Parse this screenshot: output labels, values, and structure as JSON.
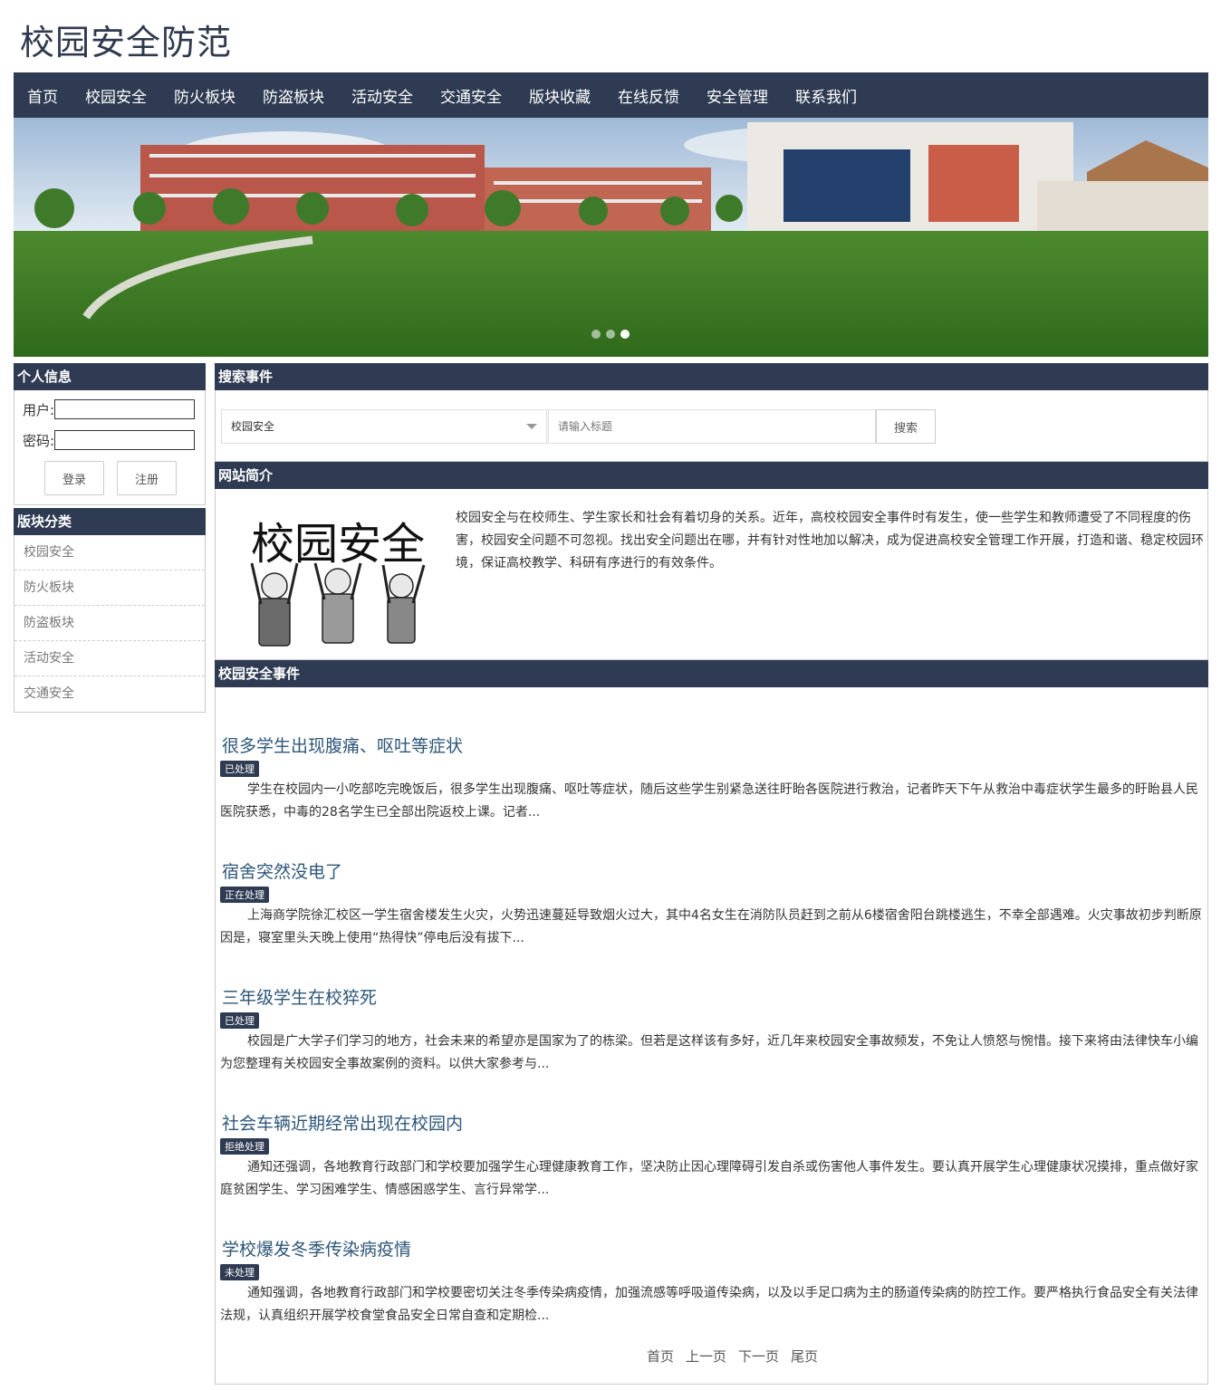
{
  "site": {
    "title": "校园安全防范"
  },
  "nav": [
    "首页",
    "校园安全",
    "防火板块",
    "防盗板块",
    "活动安全",
    "交通安全",
    "版块收藏",
    "在线反馈",
    "安全管理",
    "联系我们"
  ],
  "personal": {
    "heading": "个人信息",
    "user_label": "用户:",
    "pass_label": "密码:",
    "login_label": "登录",
    "register_label": "注册"
  },
  "categories": {
    "heading": "版块分类",
    "items": [
      "校园安全",
      "防火板块",
      "防盗板块",
      "活动安全",
      "交通安全"
    ]
  },
  "search": {
    "heading": "搜索事件",
    "selected": "校园安全",
    "placeholder": "请输入标题",
    "button": "搜索"
  },
  "intro": {
    "heading": "网站简介",
    "image_text": "校园安全",
    "text": "校园安全与在校师生、学生家长和社会有着切身的关系。近年，高校校园安全事件时有发生，使一些学生和教师遭受了不同程度的伤害，校园安全问题不可忽视。找出安全问题出在哪，并有针对性地加以解决，成为促进高校安全管理工作开展，打造和谐、稳定校园环境，保证高校教学、科研有序进行的有效条件。"
  },
  "events": {
    "heading": "校园安全事件",
    "items": [
      {
        "title": "很多学生出现腹痛、呕吐等症状",
        "status": "已处理",
        "text": "学生在校园内一小吃部吃完晚饭后，很多学生出现腹痛、呕吐等症状，随后这些学生别紧急送往盱眙各医院进行救治，记者昨天下午从救治中毒症状学生最多的盱眙县人民医院获悉，中毒的28名学生已全部出院返校上课。记者..."
      },
      {
        "title": "宿舍突然没电了",
        "status": "正在处理",
        "text": "上海商学院徐汇校区一学生宿舍楼发生火灾，火势迅速蔓延导致烟火过大，其中4名女生在消防队员赶到之前从6楼宿舍阳台跳楼逃生，不幸全部遇难。火灾事故初步判断原因是，寝室里头天晚上使用“热得快”停电后没有拔下..."
      },
      {
        "title": "三年级学生在校猝死",
        "status": "已处理",
        "text": "校园是广大学子们学习的地方，社会未来的希望亦是国家为了的栋梁。但若是这样该有多好，近几年来校园安全事故频发，不免让人愤怒与惋惜。接下来将由法律快车小编为您整理有关校园安全事故案例的资料。以供大家参考与..."
      },
      {
        "title": "社会车辆近期经常出现在校园内",
        "status": "拒绝处理",
        "text": "通知还强调，各地教育行政部门和学校要加强学生心理健康教育工作，坚决防止因心理障碍引发自杀或伤害他人事件发生。要认真开展学生心理健康状况摸排，重点做好家庭贫困学生、学习困难学生、情感困惑学生、言行异常学..."
      },
      {
        "title": "学校爆发冬季传染病疫情",
        "status": "未处理",
        "text": "通知强调，各地教育行政部门和学校要密切关注冬季传染病疫情，加强流感等呼吸道传染病，以及以手足口病为主的肠道传染病的防控工作。要严格执行食品安全有关法律法规，认真组织开展学校食堂食品安全日常自查和定期检..."
      }
    ]
  },
  "pager": [
    "首页",
    "上一页",
    "下一页",
    "尾页"
  ],
  "banner": {
    "slides": 3,
    "active_slide": 3
  }
}
